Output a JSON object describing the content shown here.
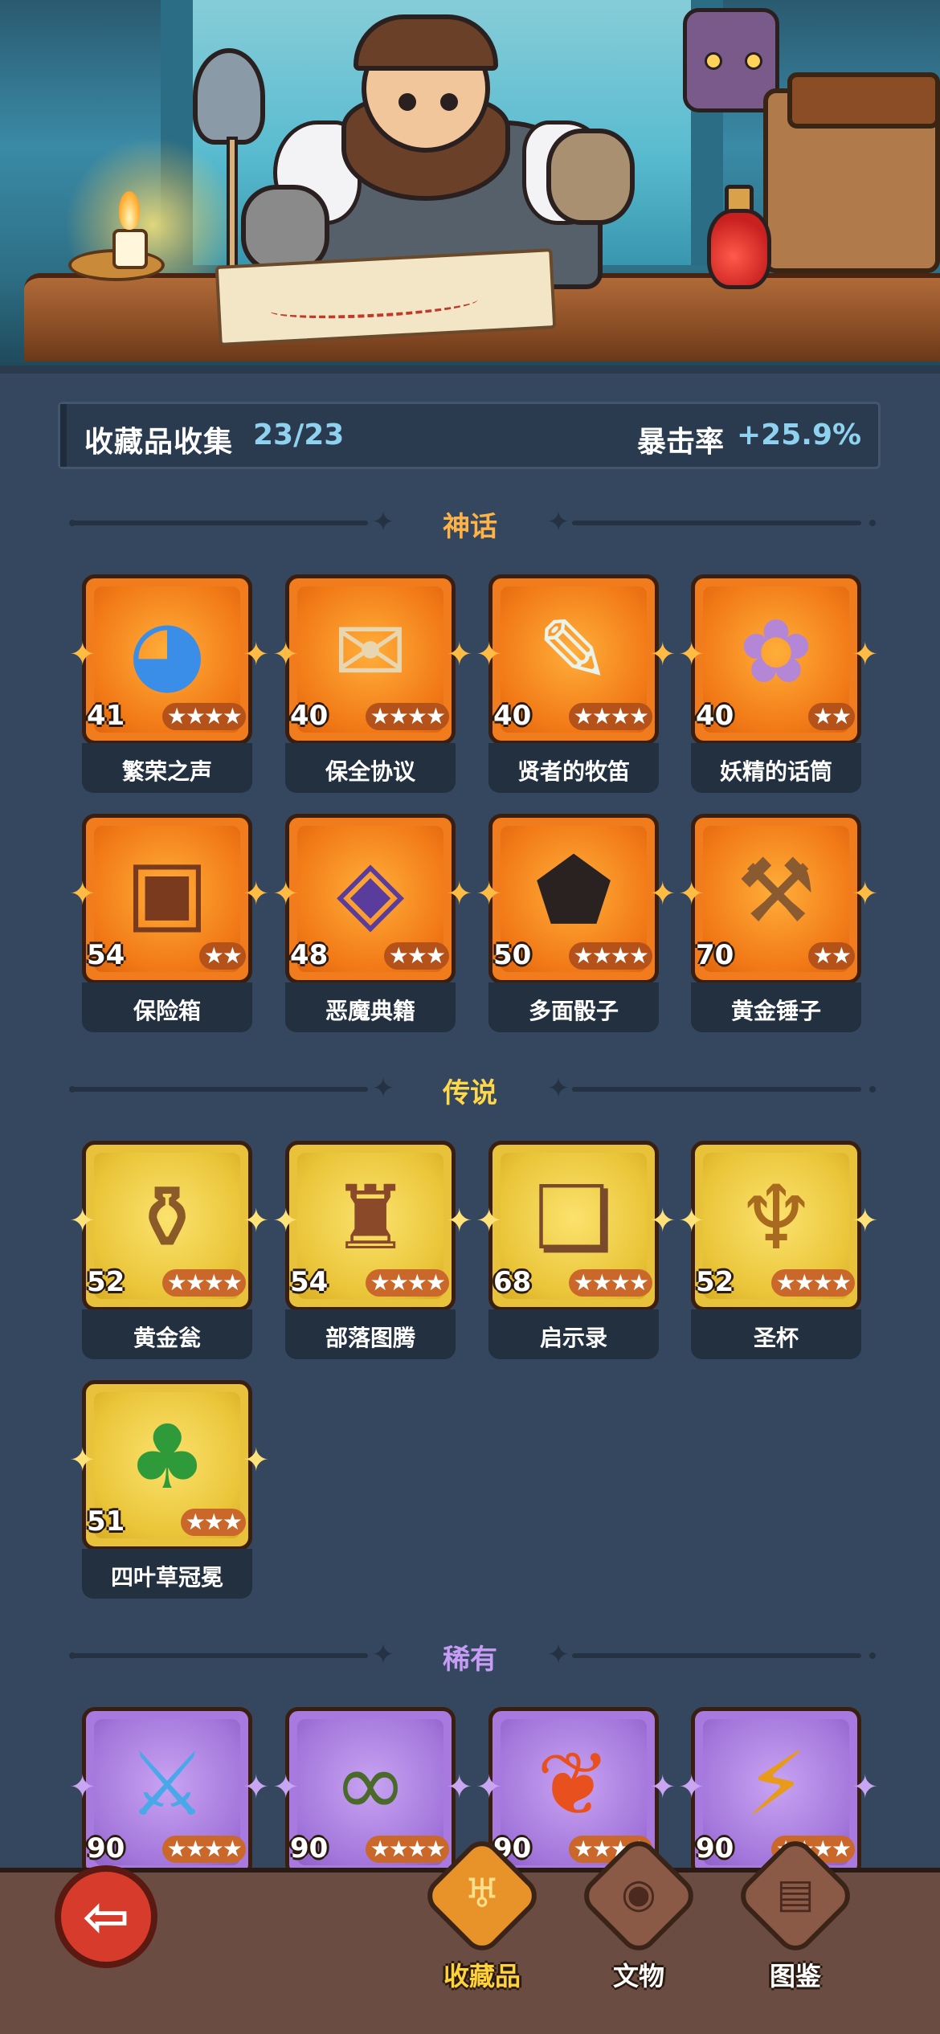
{
  "stats": {
    "collection_label": "收藏品收集",
    "collection_count": "23/23",
    "crit_label": "暴击率",
    "crit_value": "+25.9%"
  },
  "colors": {
    "mythic": "#f07c1d",
    "legendary": "#e8c23a",
    "rare": "#a87adf",
    "mythic_title": "#ffb347",
    "legendary_title": "#ffd84a",
    "rare_title": "#c79cf5",
    "accent_blue": "#8fd2f0"
  },
  "sections": [
    {
      "title": "神话",
      "rarity": "mythic",
      "items": [
        {
          "level": "41",
          "stars": "★★★★",
          "name": "繁荣之声",
          "icon": "blue-spirit-icon"
        },
        {
          "level": "40",
          "stars": "★★★★",
          "name": "保全协议",
          "icon": "scroll-icon"
        },
        {
          "level": "40",
          "stars": "★★★★",
          "name": "贤者的牧笛",
          "icon": "flute-icon"
        },
        {
          "level": "40",
          "stars": "★★",
          "name": "妖精的话筒",
          "icon": "microphone-icon"
        },
        {
          "level": "54",
          "stars": "★★",
          "name": "保险箱",
          "icon": "treasure-chest-icon"
        },
        {
          "level": "48",
          "stars": "★★★",
          "name": "恶魔典籍",
          "icon": "demon-book-icon"
        },
        {
          "level": "50",
          "stars": "★★★★",
          "name": "多面骰子",
          "icon": "dice-icon"
        },
        {
          "level": "70",
          "stars": "★★",
          "name": "黄金锤子",
          "icon": "hammer-icon"
        }
      ]
    },
    {
      "title": "传说",
      "rarity": "legendary",
      "items": [
        {
          "level": "52",
          "stars": "★★★★",
          "name": "黄金瓮",
          "icon": "golden-urn-icon"
        },
        {
          "level": "54",
          "stars": "★★★★",
          "name": "部落图腾",
          "icon": "totem-icon"
        },
        {
          "level": "68",
          "stars": "★★★★",
          "name": "启示录",
          "icon": "open-book-icon"
        },
        {
          "level": "52",
          "stars": "★★★★",
          "name": "圣杯",
          "icon": "chalice-icon"
        },
        {
          "level": "51",
          "stars": "★★★",
          "name": "四叶草冠冕",
          "icon": "clover-crown-icon"
        }
      ]
    },
    {
      "title": "稀有",
      "rarity": "rare",
      "items": [
        {
          "level": "90",
          "stars": "★★★★",
          "name": "",
          "icon": "ice-dagger-icon"
        },
        {
          "level": "90",
          "stars": "★★★★",
          "name": "",
          "icon": "thorn-ring-icon"
        },
        {
          "level": "90",
          "stars": "★★★★",
          "name": "",
          "icon": "fire-feather-icon"
        },
        {
          "level": "90",
          "stars": "★★★★",
          "name": "",
          "icon": "lightning-card-icon"
        }
      ]
    }
  ],
  "nav": {
    "back_icon": "back-arrow-icon",
    "tabs": [
      {
        "label": "收藏品",
        "icon": "lyre-icon",
        "active": true
      },
      {
        "label": "文物",
        "icon": "eye-icon",
        "active": false
      },
      {
        "label": "图鉴",
        "icon": "book-icon",
        "active": false
      }
    ]
  }
}
